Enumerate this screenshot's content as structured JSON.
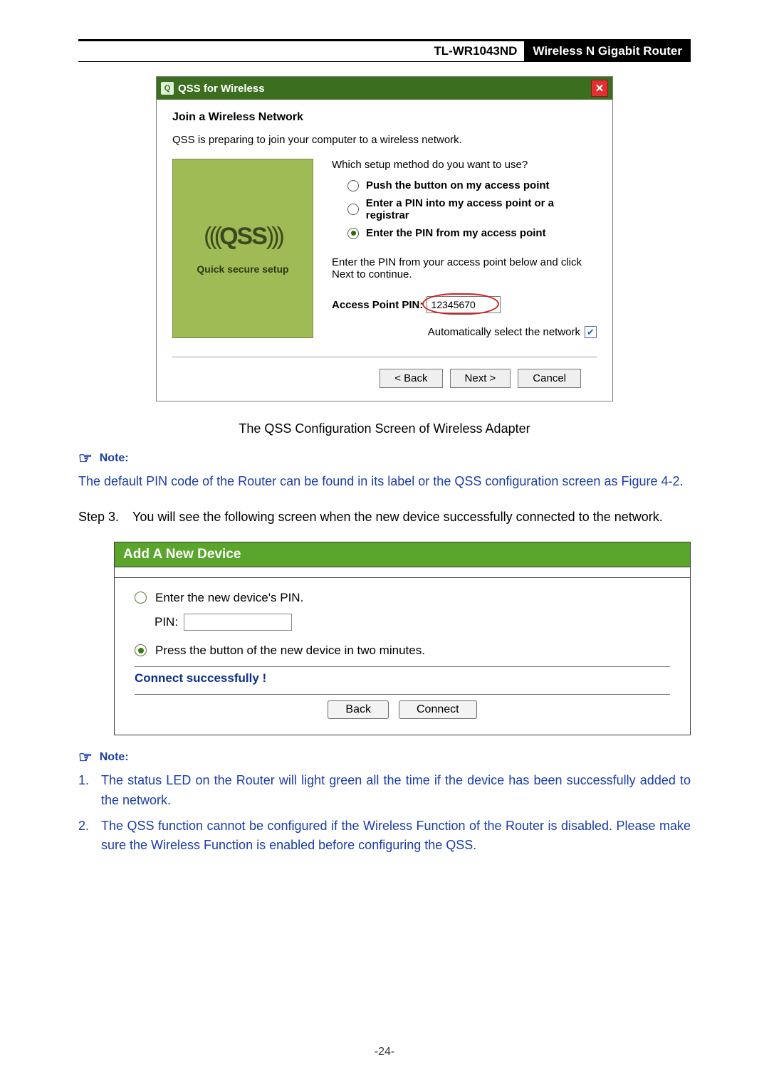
{
  "header": {
    "model": "TL-WR1043ND",
    "product": "Wireless N Gigabit Router"
  },
  "dialog": {
    "title": "QSS for Wireless",
    "join": "Join a Wireless Network",
    "prepare": "QSS is preparing to join your computer to a wireless network.",
    "qss_label": "Quick secure setup",
    "question": "Which setup method do you want to use?",
    "opt1": "Push the button on my access point",
    "opt2": "Enter a PIN into my access point or a registrar",
    "opt3": "Enter the PIN from my access point",
    "hint": "Enter the PIN from your access point below and click Next to continue.",
    "pin_label": "Access Point PIN:",
    "pin_value": "12345670",
    "auto": "Automatically select the network",
    "back": "< Back",
    "next": "Next >",
    "cancel": "Cancel"
  },
  "caption": "The QSS Configuration Screen of Wireless Adapter",
  "note": "Note:",
  "note_body": "The default PIN code of the Router can be found in its label or the QSS configuration screen as Figure 4-2.",
  "step": {
    "label": "Step 3.",
    "text": "You will see the following screen when the new device successfully connected to the network."
  },
  "panel": {
    "title": "Add A New Device",
    "opt_pin": "Enter the new device's PIN.",
    "pin_label": "PIN:",
    "opt_btn": "Press the button of the new device in two minutes.",
    "ok": "Connect successfully !",
    "back": "Back",
    "connect": "Connect"
  },
  "notes_list": {
    "n1": "The status LED on the Router will light green all the time if the device has been successfully added to the network.",
    "n2": "The QSS function cannot be configured if the Wireless Function of the Router is disabled. Please make sure the Wireless Function is enabled before configuring the QSS."
  },
  "page_number": "-24-"
}
